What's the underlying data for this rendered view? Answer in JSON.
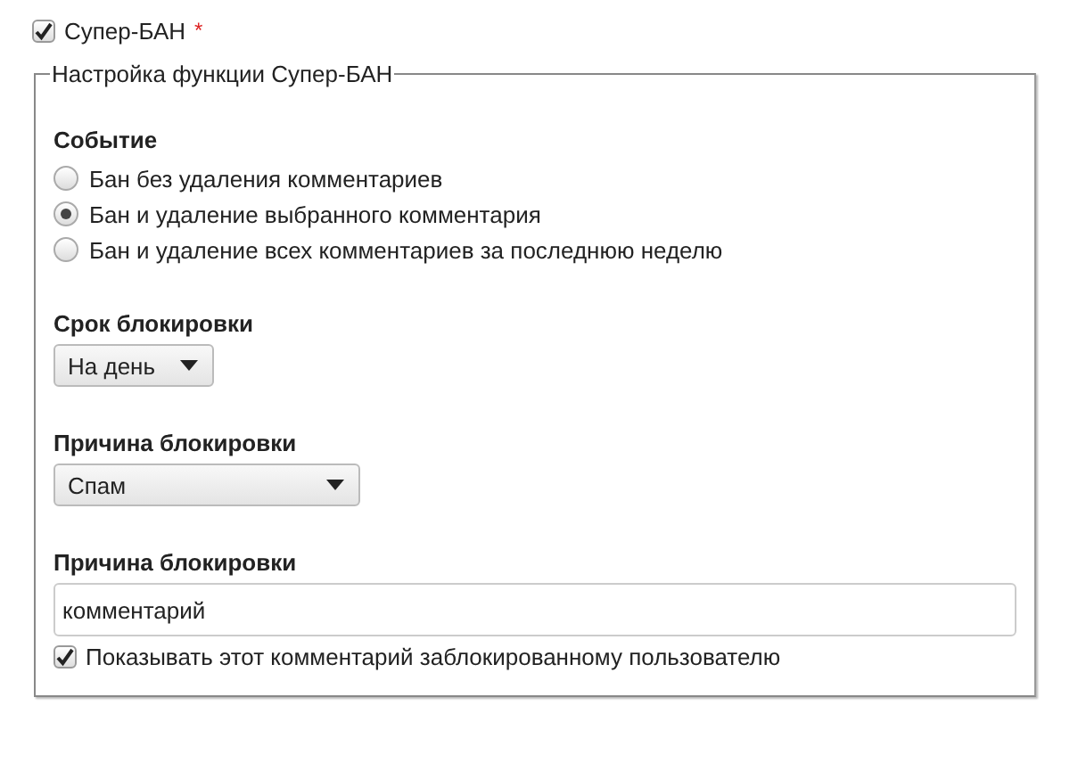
{
  "enable": {
    "label": "Супер-БАН",
    "required_mark": "*",
    "checked": true
  },
  "fieldset": {
    "legend": "Настройка функции Супер-БАН",
    "event": {
      "label": "Событие",
      "options": [
        {
          "label": "Бан без удаления комментариев",
          "selected": false
        },
        {
          "label": "Бан и удаление выбранного комментария",
          "selected": true
        },
        {
          "label": "Бан и удаление всех комментариев за последнюю неделю",
          "selected": false
        }
      ]
    },
    "duration": {
      "label": "Срок блокировки",
      "value": "На день"
    },
    "reason_select": {
      "label": "Причина блокировки",
      "value": "Спам"
    },
    "reason_text": {
      "label": "Причина блокировки",
      "value": "комментарий"
    },
    "show_comment": {
      "label": "Показывать этот комментарий заблокированному пользователю",
      "checked": true
    }
  }
}
